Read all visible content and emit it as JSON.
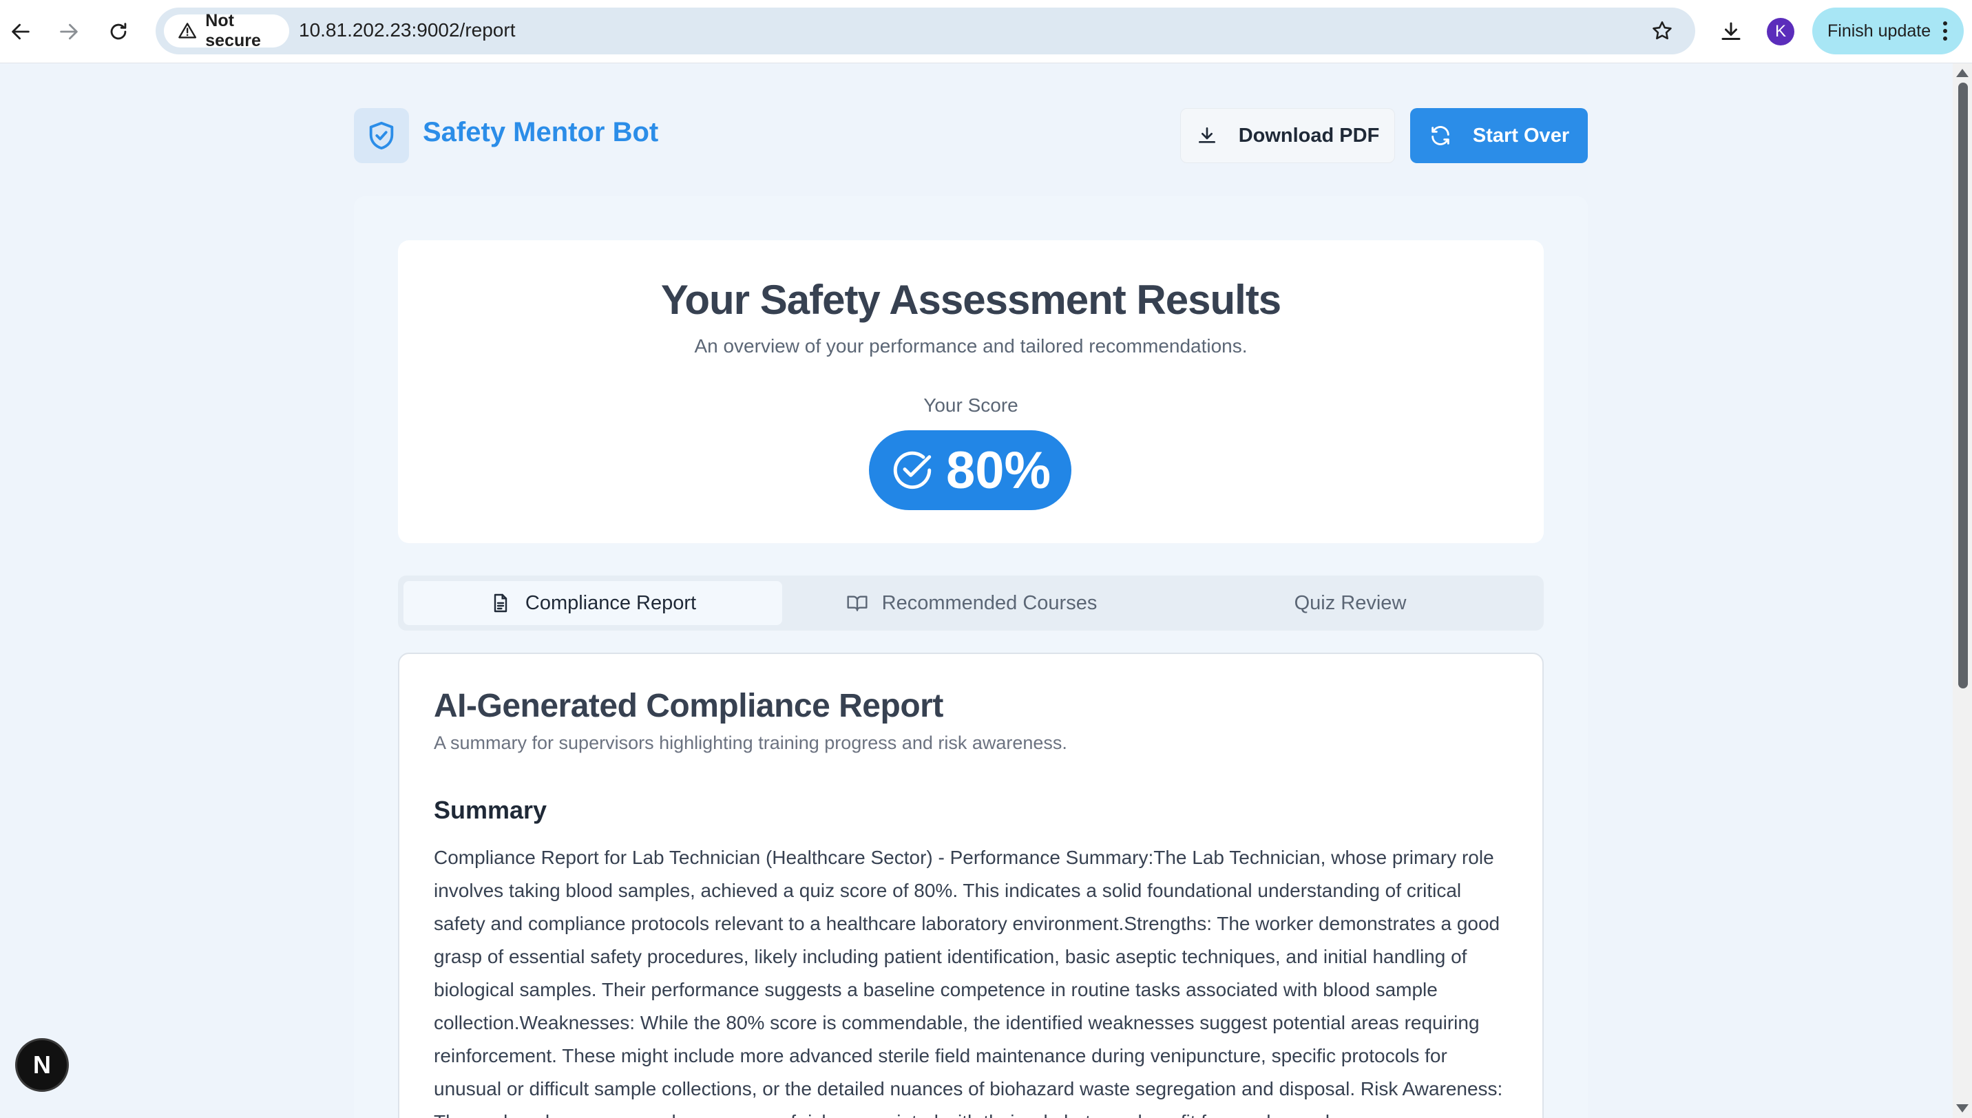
{
  "browser": {
    "security_label": "Not secure",
    "url": "10.81.202.23:9002/report",
    "avatar_letter": "K",
    "finish_update_label": "Finish update"
  },
  "header": {
    "app_title": "Safety Mentor Bot",
    "download_pdf_label": "Download PDF",
    "start_over_label": "Start Over"
  },
  "results": {
    "title": "Your Safety Assessment Results",
    "subtitle": "An overview of your performance and tailored recommendations.",
    "score_label": "Your Score",
    "score_value": "80%"
  },
  "tabs": [
    {
      "label": "Compliance Report",
      "icon": "document-icon",
      "active": true
    },
    {
      "label": "Recommended Courses",
      "icon": "book-open-icon",
      "active": false
    },
    {
      "label": "Quiz Review",
      "active": false
    }
  ],
  "report": {
    "title": "AI-Generated Compliance Report",
    "subtitle": "A summary for supervisors highlighting training progress and risk awareness.",
    "summary_heading": "Summary",
    "summary_text": "Compliance Report for Lab Technician (Healthcare Sector) - Performance Summary:The Lab Technician, whose primary role involves taking blood samples, achieved a quiz score of 80%. This indicates a solid foundational understanding of critical safety and compliance protocols relevant to a healthcare laboratory environment.Strengths: The worker demonstrates a good grasp of essential safety procedures, likely including patient identification, basic aseptic techniques, and initial handling of biological samples. Their performance suggests a baseline competence in routine tasks associated with blood sample collection.Weaknesses: While the 80% score is commendable, the identified weaknesses suggest potential areas requiring reinforcement. These might include more advanced sterile field maintenance during venipuncture, specific protocols for unusual or difficult sample collections, or the detailed nuances of biohazard waste segregation and disposal. Risk Awareness: The worker shows a general awareness of risks associated with their role but may benefit from enhanced"
  },
  "floating_badge": "N",
  "colors": {
    "accent": "#2b8de8",
    "page_bg": "#eef4fb"
  }
}
